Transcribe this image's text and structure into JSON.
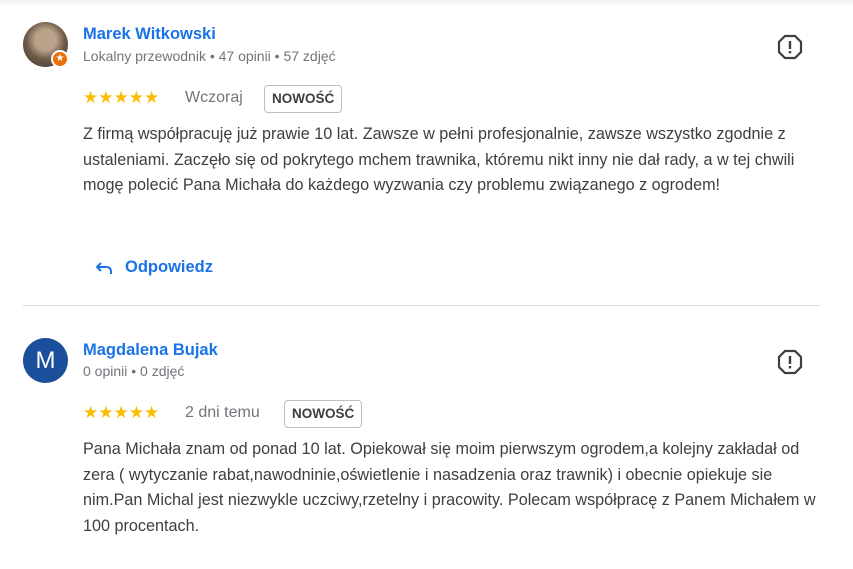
{
  "reviews": [
    {
      "author": "Marek Witkowski",
      "meta": "Lokalny przewodnik • 47 opinii • 57 zdjęć",
      "stars": "★★★★★",
      "date": "Wczoraj",
      "badge": "NOWOŚĆ",
      "text": "Z firmą współpracuję już prawie 10 lat. Zawsze w pełni profesjonalnie, zawsze wszystko zgodnie z ustaleniami. Zaczęło się od pokrytego mchem trawnika, któremu nikt inny nie dał rady, a w tej chwili mogę polecić Pana Michała do każdego wyzwania czy problemu związanego z ogrodem!",
      "reply_label": "Odpowiedz"
    },
    {
      "author": "Magdalena Bujak",
      "avatar_letter": "M",
      "meta": "0 opinii • 0 zdjęć",
      "stars": "★★★★★",
      "date": "2 dni temu",
      "badge": "NOWOŚĆ",
      "text": "Pana Michała znam od ponad 10 lat. Opiekował się moim pierwszym ogrodem,a kolejny zakładał od zera ( wytyczanie rabat,nawodninie,oświetlenie i nasadzenia oraz trawnik) i obecnie opiekuje sie nim.Pan Michal jest niezwykle uczciwy,rzetelny i pracowity. Polecam współpracę z Panem Michałem w 100 procentach."
    }
  ],
  "colors": {
    "link": "#1a73e8",
    "star": "#fbbc04",
    "avatar_bg": "#1b4f9c",
    "guide_badge": "#e8710a"
  },
  "icons": {
    "flag": "report-icon",
    "reply": "reply-arrow-icon"
  }
}
